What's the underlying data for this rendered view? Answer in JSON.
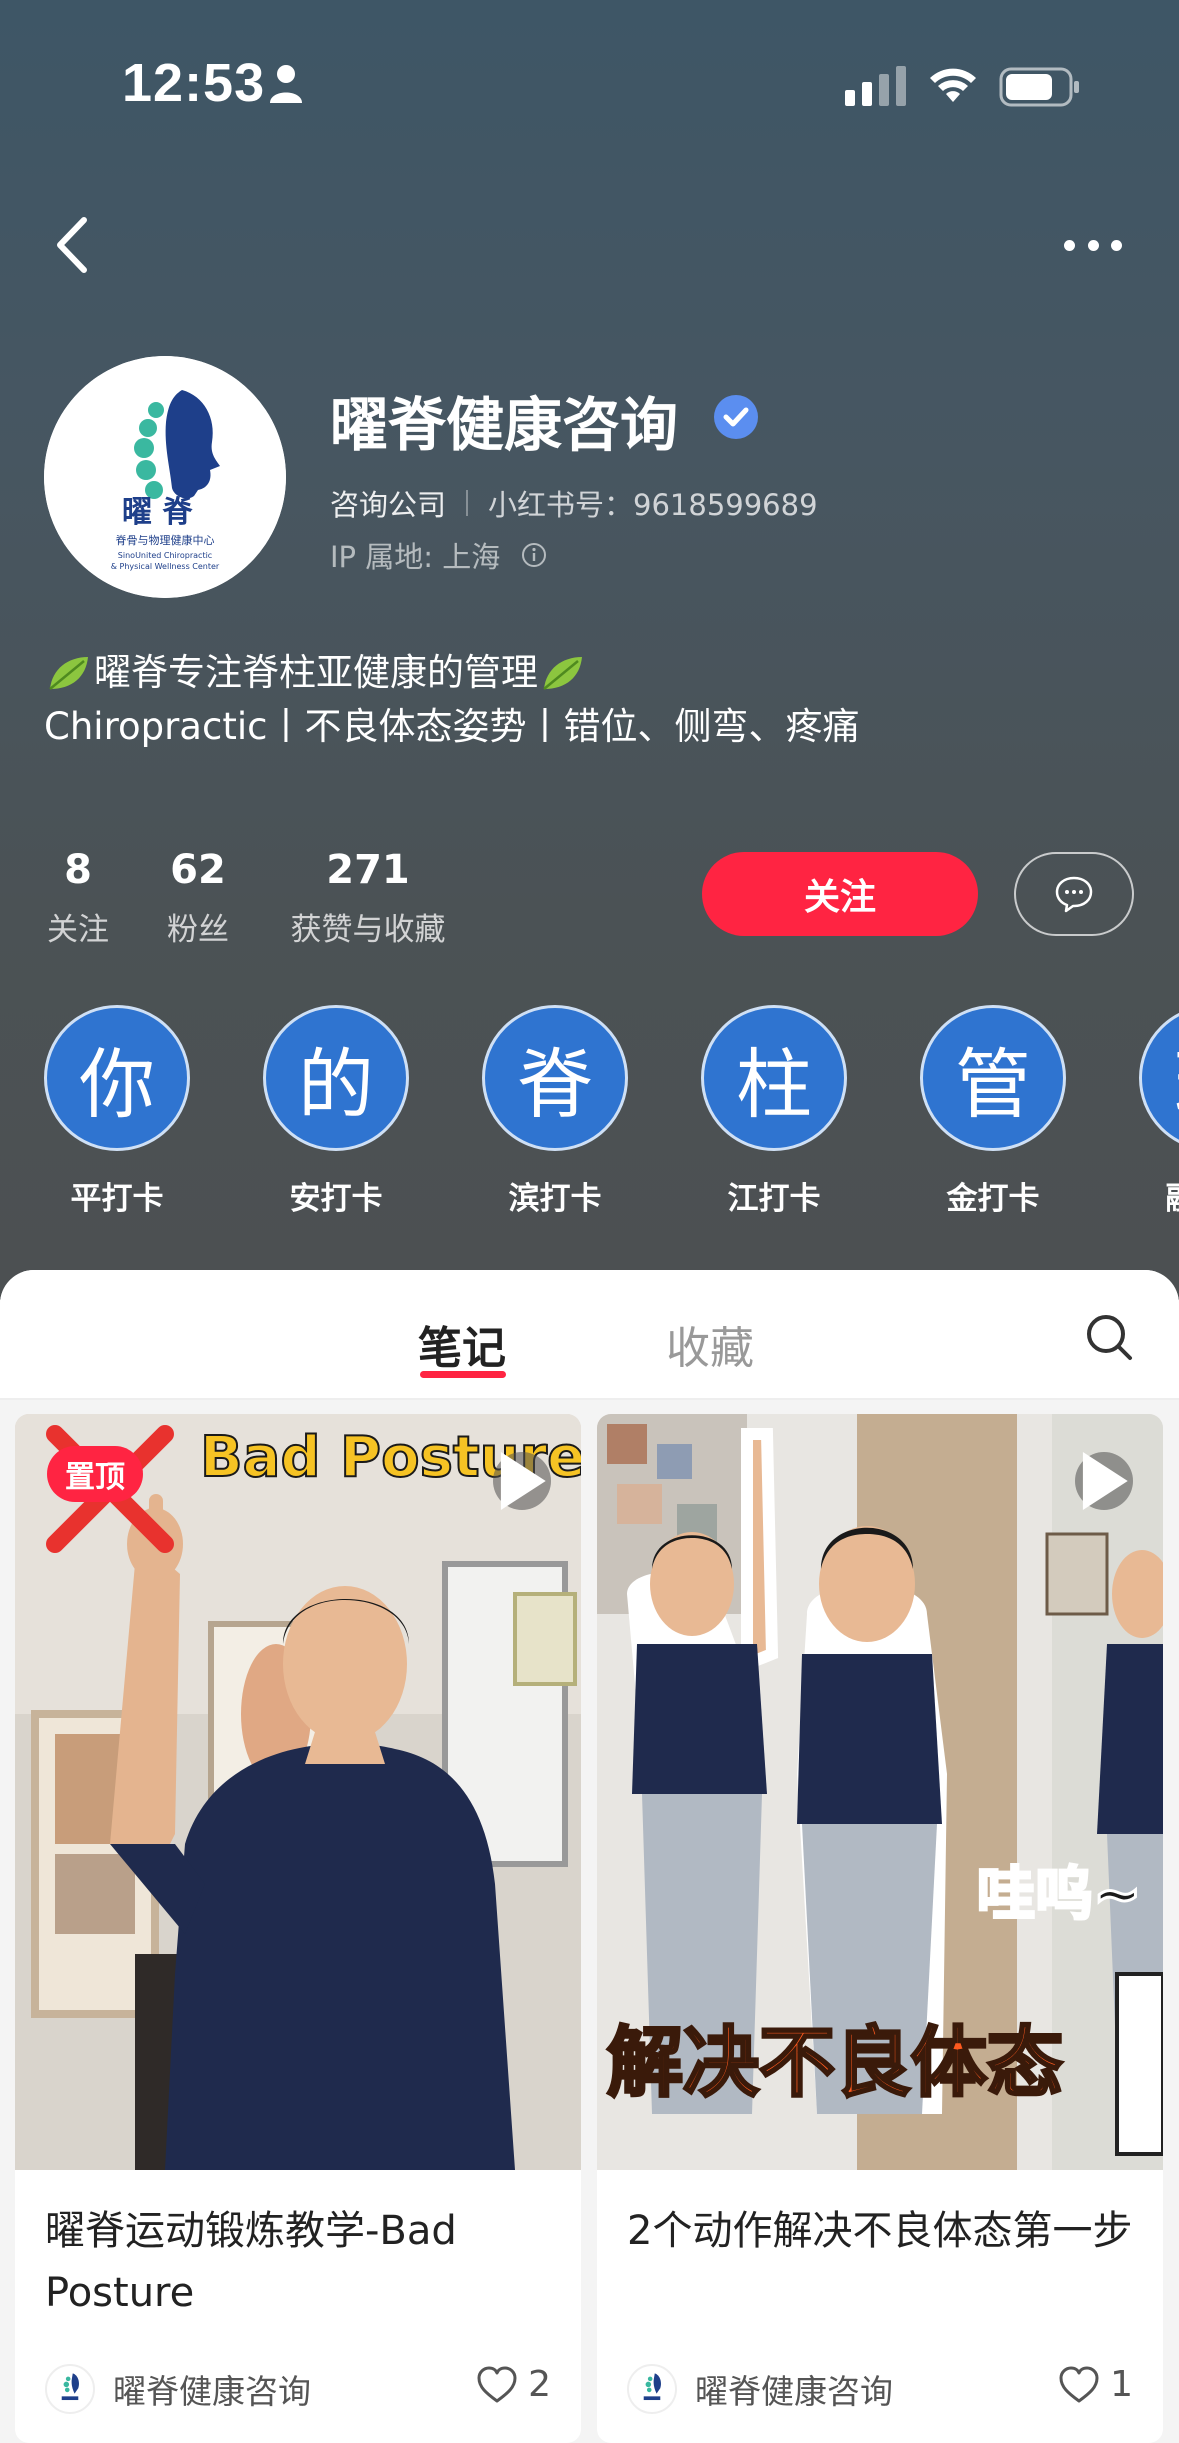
{
  "status_bar": {
    "time": "12:53"
  },
  "profile": {
    "name": "曜脊健康咨询",
    "type": "咨询公司",
    "red_id": "小红书号：9618599689",
    "ip": "IP 属地: 上海",
    "logo_text_main": "曜 脊",
    "logo_text_cn": "脊骨与物理健康中心",
    "logo_text_en1": "SinoUnited Chiropractic",
    "logo_text_en2": "& Physical Wellness Center"
  },
  "bio": {
    "line1": "曜脊专注脊柱亚健康的管理",
    "line2": "Chiropractic丨不良体态姿势丨错位、侧弯、疼痛"
  },
  "stats": [
    {
      "num": "8",
      "label": "关注"
    },
    {
      "num": "62",
      "label": "粉丝"
    },
    {
      "num": "271",
      "label": "获赞与收藏"
    }
  ],
  "actions": {
    "follow_label": "关注"
  },
  "highlights": [
    {
      "char": "你",
      "label": "平打卡"
    },
    {
      "char": "的",
      "label": "安打卡"
    },
    {
      "char": "脊",
      "label": "滨打卡"
    },
    {
      "char": "柱",
      "label": "江打卡"
    },
    {
      "char": "管",
      "label": "金打卡"
    },
    {
      "char": "理",
      "label": "融打卡"
    }
  ],
  "tabs": [
    {
      "label": "笔记",
      "active": true
    },
    {
      "label": "收藏",
      "active": false
    }
  ],
  "notes": [
    {
      "title": "曜脊运动锻炼教学-Bad Posture",
      "author": "曜脊健康咨询",
      "likes": "2",
      "badge": "置顶",
      "cover_text": "Bad Posture"
    },
    {
      "title": "2个动作解决不良体态第一步",
      "author": "曜脊健康咨询",
      "likes": "1",
      "cover_text_top": "哇呜~",
      "cover_text_bottom": "解决不良体态"
    }
  ],
  "colors": {
    "accent": "#ff2442",
    "highlight_blue": "#2f74d0",
    "verified": "#5b8ef0"
  }
}
